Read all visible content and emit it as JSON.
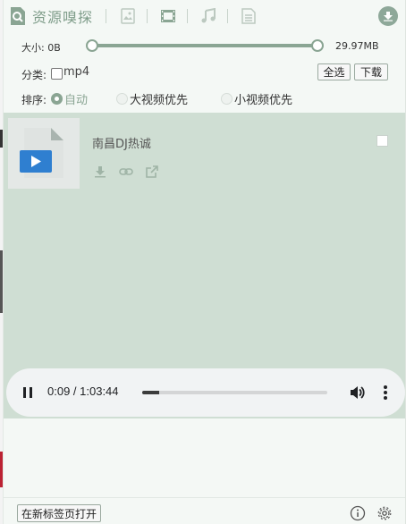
{
  "header": {
    "title": "资源嗅探",
    "tabs": [
      "image-tab",
      "video-tab",
      "music-tab",
      "document-tab"
    ]
  },
  "filters": {
    "size_label": "大小: 0B",
    "size_max": "29.97MB",
    "range_min_fraction": 0,
    "range_max_fraction": 1,
    "category_label": "分类:",
    "category_option": "mp4",
    "select_all": "全选",
    "download": "下载",
    "sort_label": "排序:",
    "sort_options": [
      "自动",
      "大视频优先",
      "小视频优先"
    ],
    "sort_selected": "自动"
  },
  "items": [
    {
      "title": "南昌DJ热诚"
    }
  ],
  "player": {
    "time": "0:09 / 1:03:44",
    "progress_fraction": 0.09
  },
  "footer": {
    "open_new_tab": "在新标签页打开"
  },
  "colors": {
    "accent": "#8aa593",
    "content_bg": "#cfded3",
    "header_text": "#7f9d8a"
  }
}
